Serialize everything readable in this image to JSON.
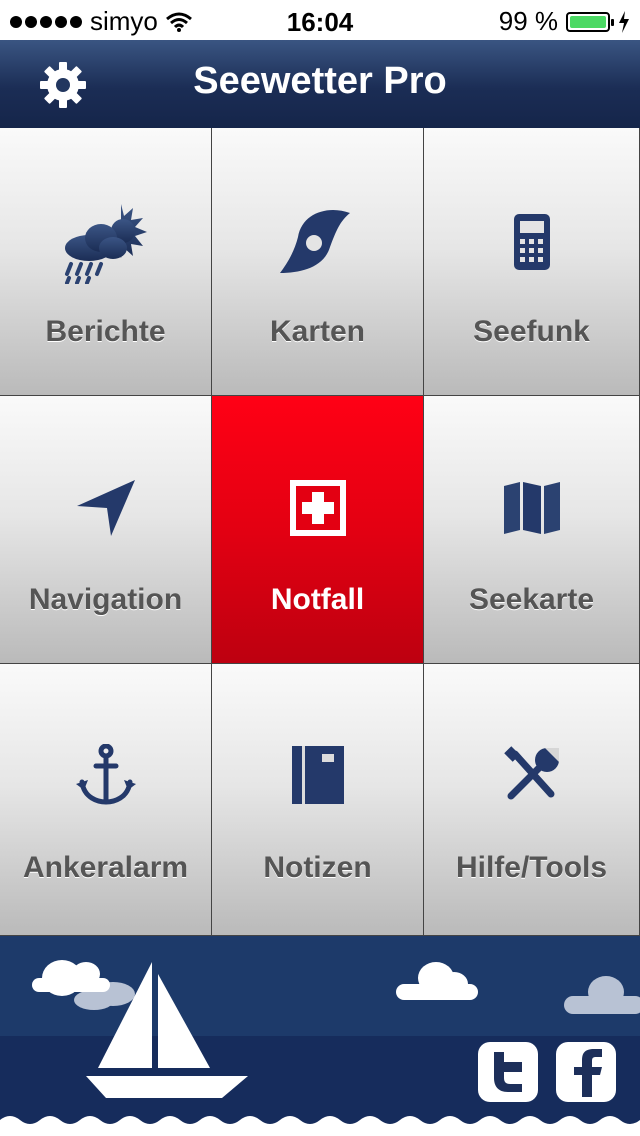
{
  "status": {
    "carrier": "simyo",
    "time": "16:04",
    "battery": "99 %"
  },
  "nav": {
    "title": "Seewetter Pro"
  },
  "tiles": [
    {
      "label": "Berichte"
    },
    {
      "label": "Karten"
    },
    {
      "label": "Seefunk"
    },
    {
      "label": "Navigation"
    },
    {
      "label": "Notfall"
    },
    {
      "label": "Seekarte"
    },
    {
      "label": "Ankeralarm"
    },
    {
      "label": "Notizen"
    },
    {
      "label": "Hilfe/Tools"
    }
  ],
  "icons": [
    "gear-icon",
    "weather-icon",
    "hurricane-icon",
    "radio-icon",
    "navigation-arrow-icon",
    "first-aid-icon",
    "map-icon",
    "anchor-icon",
    "notebook-icon",
    "tools-icon",
    "sailboat-icon",
    "twitter-icon",
    "facebook-icon"
  ],
  "colors": {
    "navbar": "#1b2d55",
    "emergency": "#e30012",
    "footer_sky": "#1d3a6a",
    "footer_sea": "#162c5c",
    "battery": "#4cd964"
  }
}
